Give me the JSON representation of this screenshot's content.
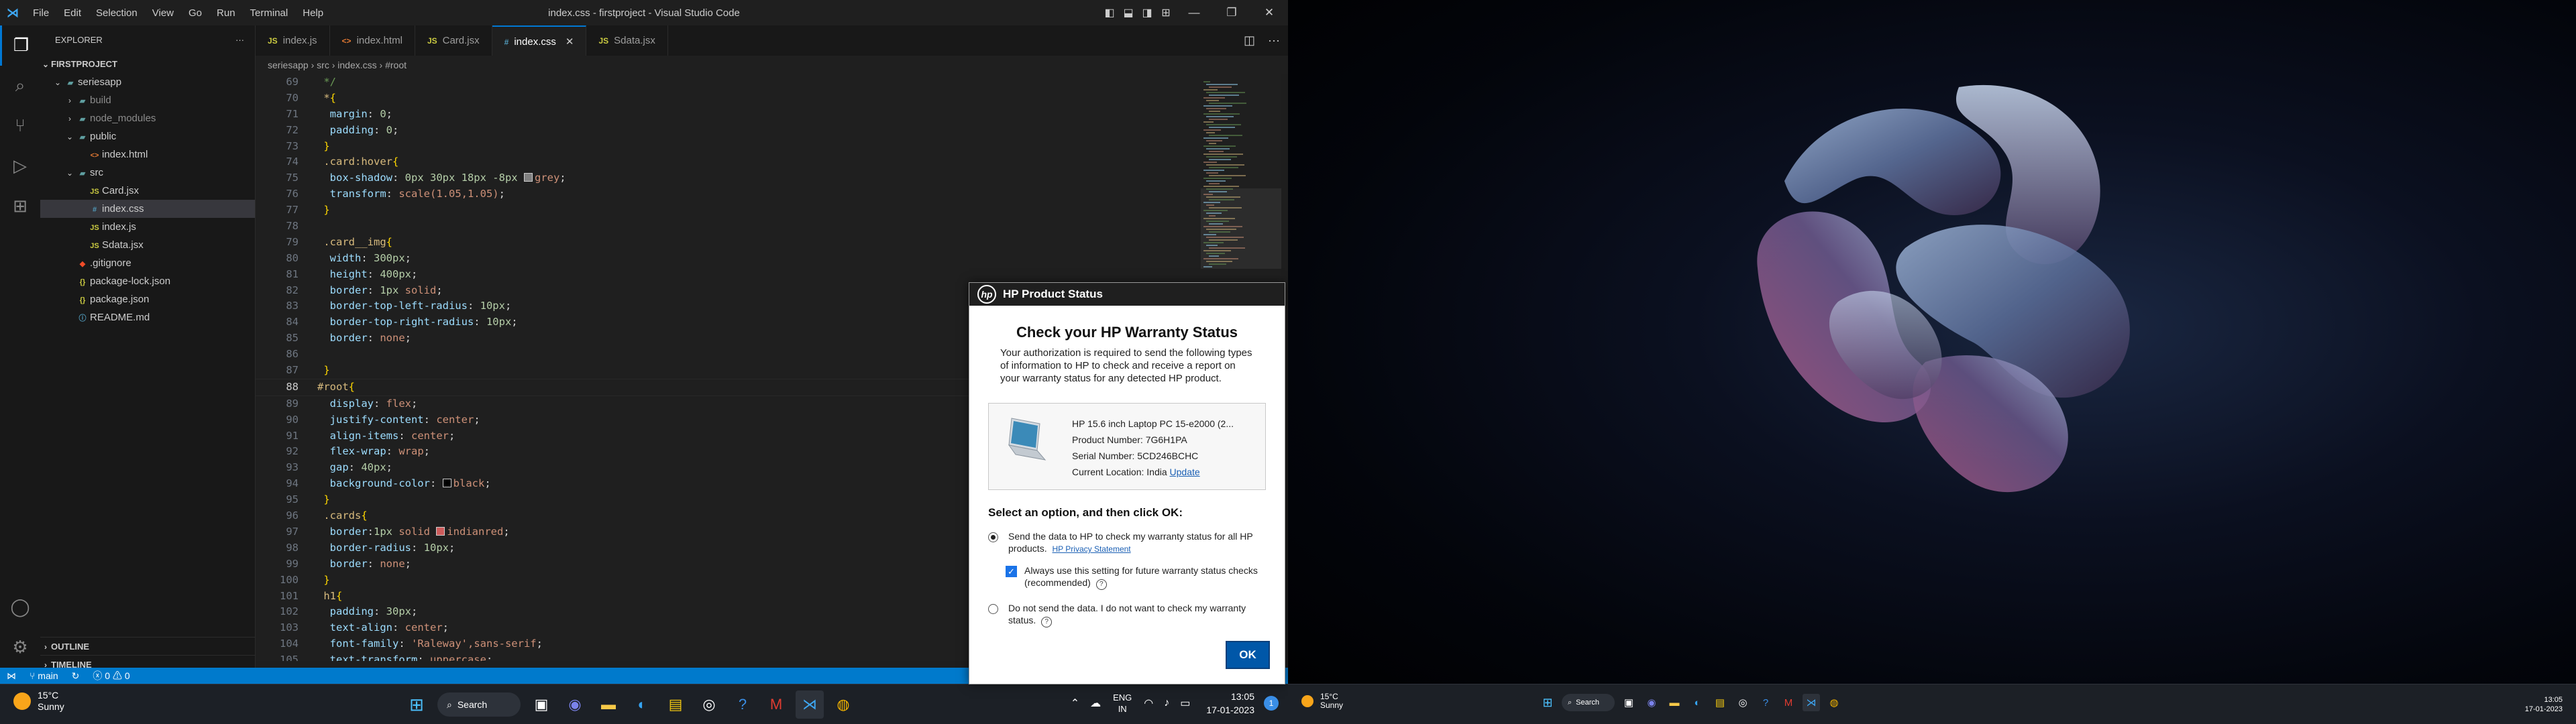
{
  "vscode": {
    "window_title": "index.css - firstproject - Visual Studio Code",
    "menu": [
      "File",
      "Edit",
      "Selection",
      "View",
      "Go",
      "Run",
      "Terminal",
      "Help"
    ],
    "explorer": {
      "header": "EXPLORER",
      "project": "FIRSTPROJECT",
      "tree": [
        {
          "label": "seriesapp",
          "icon": "folder-open",
          "depth": 1
        },
        {
          "label": "build",
          "icon": "folder",
          "depth": 2
        },
        {
          "label": "node_modules",
          "icon": "folder",
          "depth": 2
        },
        {
          "label": "public",
          "icon": "folder-open",
          "depth": 2
        },
        {
          "label": "index.html",
          "icon": "html",
          "depth": 3
        },
        {
          "label": "src",
          "icon": "folder-open",
          "depth": 2
        },
        {
          "label": "Card.jsx",
          "icon": "js",
          "depth": 3
        },
        {
          "label": "index.css",
          "icon": "css",
          "depth": 3
        },
        {
          "label": "index.js",
          "icon": "js",
          "depth": 3
        },
        {
          "label": "Sdata.jsx",
          "icon": "js",
          "depth": 3
        },
        {
          "label": ".gitignore",
          "icon": "git",
          "depth": 2
        },
        {
          "label": "package-lock.json",
          "icon": "json",
          "depth": 2
        },
        {
          "label": "package.json",
          "icon": "json",
          "depth": 2
        },
        {
          "label": "README.md",
          "icon": "md",
          "depth": 2
        }
      ],
      "outline": "OUTLINE",
      "timeline": "TIMELINE"
    },
    "tabs": [
      {
        "label": "index.js",
        "icon": "JS"
      },
      {
        "label": "index.html",
        "icon": "html"
      },
      {
        "label": "Card.jsx",
        "icon": "JS"
      },
      {
        "label": "index.css",
        "icon": "css",
        "active": true
      },
      {
        "label": "Sdata.jsx",
        "icon": "JS"
      }
    ],
    "breadcrumb": [
      "seriesapp",
      "src",
      "index.css",
      "#root"
    ],
    "code_lines": [
      {
        "n": "69",
        "tokens": [
          {
            "t": " */",
            "c": "t-com"
          }
        ]
      },
      {
        "n": "70",
        "tokens": [
          {
            "t": " *",
            "c": "t-sel"
          },
          {
            "t": "{",
            "c": "t-br"
          }
        ]
      },
      {
        "n": "71",
        "tokens": [
          {
            "t": "  margin",
            "c": "t-prop"
          },
          {
            "t": ": ",
            "c": ""
          },
          {
            "t": "0",
            "c": "t-num"
          },
          {
            "t": ";",
            "c": ""
          }
        ]
      },
      {
        "n": "72",
        "tokens": [
          {
            "t": "  padding",
            "c": "t-prop"
          },
          {
            "t": ": ",
            "c": ""
          },
          {
            "t": "0",
            "c": "t-num"
          },
          {
            "t": ";",
            "c": ""
          }
        ]
      },
      {
        "n": "73",
        "tokens": [
          {
            "t": " }",
            "c": "t-br"
          }
        ]
      },
      {
        "n": "74",
        "tokens": [
          {
            "t": " .card:hover",
            "c": "t-sel"
          },
          {
            "t": "{",
            "c": "t-br"
          }
        ]
      },
      {
        "n": "75",
        "tokens": [
          {
            "t": "  box-shadow",
            "c": "t-prop"
          },
          {
            "t": ": ",
            "c": ""
          },
          {
            "t": "0px 30px 18px -8px ",
            "c": "t-num"
          },
          {
            "t": "grey",
            "c": "t-val",
            "swatch": "#808080"
          },
          {
            "t": ";",
            "c": ""
          }
        ]
      },
      {
        "n": "76",
        "tokens": [
          {
            "t": "  transform",
            "c": "t-prop"
          },
          {
            "t": ": ",
            "c": ""
          },
          {
            "t": "scale(1.05,1.05)",
            "c": "t-val"
          },
          {
            "t": ";",
            "c": ""
          }
        ]
      },
      {
        "n": "77",
        "tokens": [
          {
            "t": " }",
            "c": "t-br"
          }
        ]
      },
      {
        "n": "78",
        "tokens": []
      },
      {
        "n": "79",
        "tokens": [
          {
            "t": " .card__img",
            "c": "t-sel"
          },
          {
            "t": "{",
            "c": "t-br"
          }
        ]
      },
      {
        "n": "80",
        "tokens": [
          {
            "t": "  width",
            "c": "t-prop"
          },
          {
            "t": ": ",
            "c": ""
          },
          {
            "t": "300px",
            "c": "t-num"
          },
          {
            "t": ";",
            "c": ""
          }
        ]
      },
      {
        "n": "81",
        "tokens": [
          {
            "t": "  height",
            "c": "t-prop"
          },
          {
            "t": ": ",
            "c": ""
          },
          {
            "t": "400px",
            "c": "t-num"
          },
          {
            "t": ";",
            "c": ""
          }
        ]
      },
      {
        "n": "82",
        "tokens": [
          {
            "t": "  border",
            "c": "t-prop"
          },
          {
            "t": ": ",
            "c": ""
          },
          {
            "t": "1px ",
            "c": "t-num"
          },
          {
            "t": "solid",
            "c": "t-val"
          },
          {
            "t": ";",
            "c": ""
          }
        ]
      },
      {
        "n": "83",
        "tokens": [
          {
            "t": "  border-top-left-radius",
            "c": "t-prop"
          },
          {
            "t": ": ",
            "c": ""
          },
          {
            "t": "10px",
            "c": "t-num"
          },
          {
            "t": ";",
            "c": ""
          }
        ]
      },
      {
        "n": "84",
        "tokens": [
          {
            "t": "  border-top-right-radius",
            "c": "t-prop"
          },
          {
            "t": ": ",
            "c": ""
          },
          {
            "t": "10px",
            "c": "t-num"
          },
          {
            "t": ";",
            "c": ""
          }
        ]
      },
      {
        "n": "85",
        "tokens": [
          {
            "t": "  border",
            "c": "t-prop"
          },
          {
            "t": ": ",
            "c": ""
          },
          {
            "t": "none",
            "c": "t-val"
          },
          {
            "t": ";",
            "c": ""
          }
        ]
      },
      {
        "n": "86",
        "tokens": []
      },
      {
        "n": "87",
        "tokens": [
          {
            "t": " }",
            "c": "t-br"
          }
        ]
      },
      {
        "n": "88",
        "tokens": [
          {
            "t": "#root",
            "c": "t-sel"
          },
          {
            "t": "{",
            "c": "t-br"
          }
        ],
        "current": true
      },
      {
        "n": "89",
        "tokens": [
          {
            "t": "  display",
            "c": "t-prop"
          },
          {
            "t": ": ",
            "c": ""
          },
          {
            "t": "flex",
            "c": "t-val"
          },
          {
            "t": ";",
            "c": ""
          }
        ]
      },
      {
        "n": "90",
        "tokens": [
          {
            "t": "  justify-content",
            "c": "t-prop"
          },
          {
            "t": ": ",
            "c": ""
          },
          {
            "t": "center",
            "c": "t-val"
          },
          {
            "t": ";",
            "c": ""
          }
        ]
      },
      {
        "n": "91",
        "tokens": [
          {
            "t": "  align-items",
            "c": "t-prop"
          },
          {
            "t": ": ",
            "c": ""
          },
          {
            "t": "center",
            "c": "t-val"
          },
          {
            "t": ";",
            "c": ""
          }
        ]
      },
      {
        "n": "92",
        "tokens": [
          {
            "t": "  flex-wrap",
            "c": "t-prop"
          },
          {
            "t": ": ",
            "c": ""
          },
          {
            "t": "wrap",
            "c": "t-val"
          },
          {
            "t": ";",
            "c": ""
          }
        ]
      },
      {
        "n": "93",
        "tokens": [
          {
            "t": "  gap",
            "c": "t-prop"
          },
          {
            "t": ": ",
            "c": ""
          },
          {
            "t": "40px",
            "c": "t-num"
          },
          {
            "t": ";",
            "c": ""
          }
        ]
      },
      {
        "n": "94",
        "tokens": [
          {
            "t": "  background-color",
            "c": "t-prop"
          },
          {
            "t": ": ",
            "c": ""
          },
          {
            "t": "black",
            "c": "t-val",
            "swatch": "#000000"
          },
          {
            "t": ";",
            "c": ""
          }
        ]
      },
      {
        "n": "95",
        "tokens": [
          {
            "t": " }",
            "c": "t-br"
          }
        ]
      },
      {
        "n": "96",
        "tokens": [
          {
            "t": " .cards",
            "c": "t-sel"
          },
          {
            "t": "{",
            "c": "t-br"
          }
        ]
      },
      {
        "n": "97",
        "tokens": [
          {
            "t": "  border",
            "c": "t-prop"
          },
          {
            "t": ":",
            "c": ""
          },
          {
            "t": "1px ",
            "c": "t-num"
          },
          {
            "t": "solid ",
            "c": "t-val"
          },
          {
            "t": "indianred",
            "c": "t-val",
            "swatch": "#cd5c5c"
          },
          {
            "t": ";",
            "c": ""
          }
        ]
      },
      {
        "n": "98",
        "tokens": [
          {
            "t": "  border-radius",
            "c": "t-prop"
          },
          {
            "t": ": ",
            "c": ""
          },
          {
            "t": "10px",
            "c": "t-num"
          },
          {
            "t": ";",
            "c": ""
          }
        ]
      },
      {
        "n": "99",
        "tokens": [
          {
            "t": "  border",
            "c": "t-prop"
          },
          {
            "t": ": ",
            "c": ""
          },
          {
            "t": "none",
            "c": "t-val"
          },
          {
            "t": ";",
            "c": ""
          }
        ]
      },
      {
        "n": "100",
        "tokens": [
          {
            "t": " }",
            "c": "t-br"
          }
        ]
      },
      {
        "n": "101",
        "tokens": [
          {
            "t": " h1",
            "c": "t-sel"
          },
          {
            "t": "{",
            "c": "t-br"
          }
        ]
      },
      {
        "n": "102",
        "tokens": [
          {
            "t": "  padding",
            "c": "t-prop"
          },
          {
            "t": ": ",
            "c": ""
          },
          {
            "t": "30px",
            "c": "t-num"
          },
          {
            "t": ";",
            "c": ""
          }
        ]
      },
      {
        "n": "103",
        "tokens": [
          {
            "t": "  text-align",
            "c": "t-prop"
          },
          {
            "t": ": ",
            "c": ""
          },
          {
            "t": "center",
            "c": "t-val"
          },
          {
            "t": ";",
            "c": ""
          }
        ]
      },
      {
        "n": "104",
        "tokens": [
          {
            "t": "  font-family",
            "c": "t-prop"
          },
          {
            "t": ": ",
            "c": ""
          },
          {
            "t": "'Raleway',sans-serif",
            "c": "t-val"
          },
          {
            "t": ";",
            "c": ""
          }
        ]
      },
      {
        "n": "105",
        "tokens": [
          {
            "t": "  text-transform",
            "c": "t-prop"
          },
          {
            "t": ": ",
            "c": ""
          },
          {
            "t": "uppercase",
            "c": "t-val"
          },
          {
            "t": ";",
            "c": ""
          }
        ]
      }
    ],
    "status": {
      "branch": "main",
      "errors": "0",
      "warnings": "0"
    }
  },
  "taskbar": {
    "weather_temp": "15°C",
    "weather_desc": "Sunny",
    "search_label": "Search",
    "lang_top": "ENG",
    "lang_bottom": "IN",
    "time": "13:05",
    "date": "17-01-2023",
    "notifications": "1"
  },
  "hp_dialog": {
    "header": "HP Product Status",
    "title": "Check your HP Warranty Status",
    "description": "Your authorization is required to send the following types of information to HP to check and receive a report on your warranty status for any detected HP product.",
    "product_name": "HP 15.6 inch Laptop PC 15-e2000 (2...",
    "product_number": "Product Number: 7G6H1PA",
    "serial_number": "Serial Number: 5CD246BCHC",
    "location": "Current Location: India",
    "update_link": "Update",
    "select_prompt": "Select an option, and then click OK:",
    "option1": "Send the data to HP to check my warranty status for all HP products.",
    "privacy_link": "HP Privacy Statement",
    "checkbox_label": "Always use this setting for future warranty status checks (recommended)",
    "option2": "Do not send the data. I do not want to check my warranty status.",
    "ok_label": "OK"
  },
  "screen2_taskbar": {
    "weather_temp": "15°C",
    "weather_desc": "Sunny",
    "search_label": "Search",
    "time": "13:05",
    "date": "17-01-2023"
  }
}
